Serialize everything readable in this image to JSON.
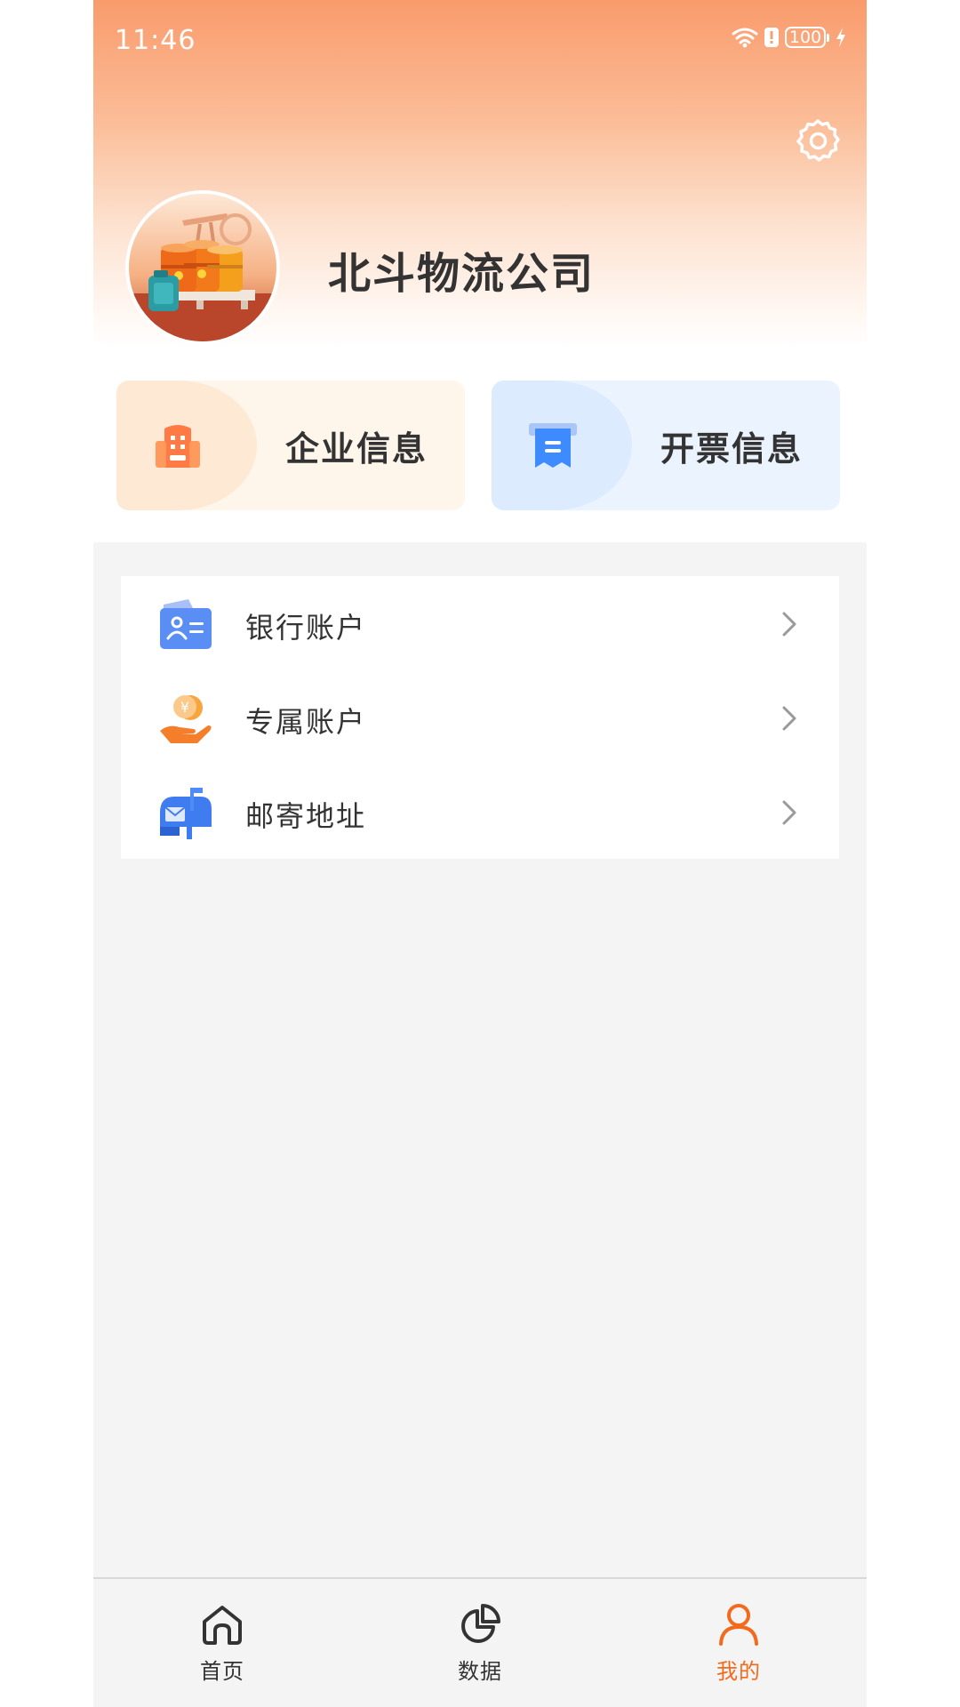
{
  "status_bar": {
    "time": "11:46",
    "battery": "100",
    "icons": [
      "wifi-icon",
      "battery-alert-icon",
      "battery-icon",
      "charging-icon"
    ]
  },
  "header": {
    "company_name": "北斗物流公司",
    "settings_icon": "gear-icon",
    "avatar_icon": "oil-barrels-avatar"
  },
  "quick_cards": [
    {
      "label": "企业信息",
      "icon": "building-icon",
      "color": "#ff7a45"
    },
    {
      "label": "开票信息",
      "icon": "receipt-icon",
      "color": "#3d8bff"
    }
  ],
  "menu": {
    "items": [
      {
        "label": "银行账户",
        "icon": "bank-card-icon"
      },
      {
        "label": "专属账户",
        "icon": "coin-hand-icon"
      },
      {
        "label": "邮寄地址",
        "icon": "mailbox-icon"
      }
    ]
  },
  "tab_bar": {
    "tabs": [
      {
        "label": "首页",
        "icon": "home-icon",
        "active": false
      },
      {
        "label": "数据",
        "icon": "pie-chart-icon",
        "active": false
      },
      {
        "label": "我的",
        "icon": "user-icon",
        "active": true
      }
    ]
  },
  "colors": {
    "accent": "#f26b1d",
    "header_top": "#f99b6c",
    "text_primary": "#333333",
    "page_bg": "#f4f4f4"
  }
}
